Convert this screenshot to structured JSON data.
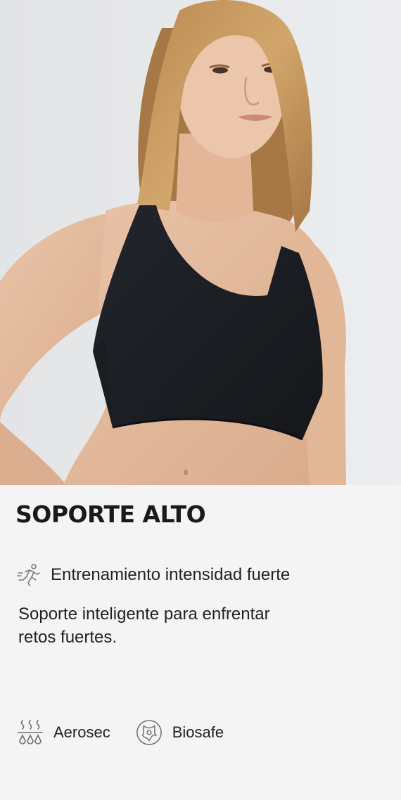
{
  "product": {
    "image_alt": "Modelo usando top deportivo negro",
    "title": "SOPORTE ALTO",
    "activity": {
      "icon": "running-person-icon",
      "label": "Entrenamiento intensidad fuerte"
    },
    "description": "Soporte inteligente para enfrentar retos fuertes.",
    "features": [
      {
        "icon": "steam-drops-icon",
        "label": "Aerosec"
      },
      {
        "icon": "molecule-shield-icon",
        "label": "Biosafe"
      }
    ]
  },
  "colors": {
    "background": "#f4f4f4",
    "image_background": "#e7e8ea",
    "text": "#1e1e1e",
    "garment": "#1b1d22"
  }
}
